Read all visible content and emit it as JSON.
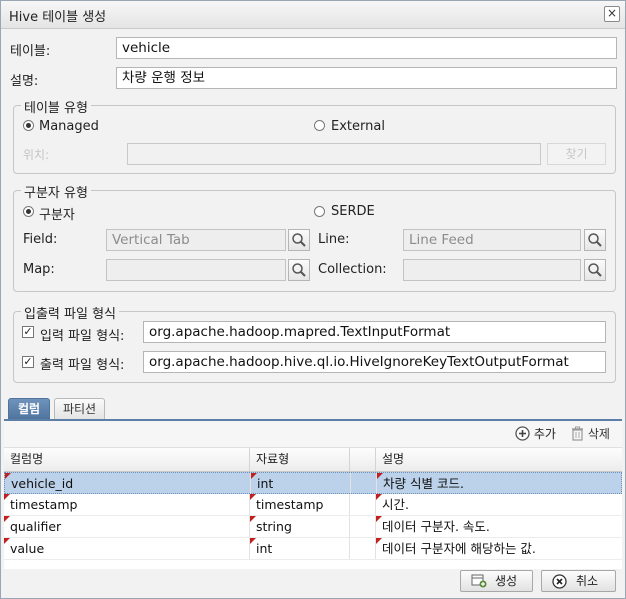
{
  "dialog": {
    "title": "Hive 테이블 생성",
    "close": "×"
  },
  "form": {
    "table_label": "테이블:",
    "table_value": "vehicle",
    "desc_label": "설명:",
    "desc_value": "차량 운행 정보"
  },
  "table_type": {
    "legend": "테이블 유형",
    "managed": "Managed",
    "external": "External",
    "location_label": "위치:",
    "location_value": "",
    "find_button": "찾기"
  },
  "delimiter": {
    "legend": "구분자 유형",
    "delimiter_option": "구분자",
    "serde_option": "SERDE",
    "field_label": "Field:",
    "field_value": "Vertical Tab",
    "line_label": "Line:",
    "line_value": "Line Feed",
    "map_label": "Map:",
    "map_value": "",
    "collection_label": "Collection:",
    "collection_value": ""
  },
  "io_format": {
    "legend": "입출력 파일 형식",
    "input_label": "입력 파일 형식:",
    "input_value": "org.apache.hadoop.mapred.TextInputFormat",
    "output_label": "출력 파일 형식:",
    "output_value": "org.apache.hadoop.hive.ql.io.HiveIgnoreKeyTextOutputFormat"
  },
  "tabs": [
    {
      "label": "컬럼"
    },
    {
      "label": "파티션"
    }
  ],
  "toolbar": {
    "add": "추가",
    "delete": "삭제"
  },
  "grid": {
    "headers": [
      "컬럼명",
      "자료형",
      "",
      "설명"
    ],
    "rows": [
      {
        "name": "vehicle_id",
        "type": "int",
        "desc": "차량 식별 코드."
      },
      {
        "name": "timestamp",
        "type": "timestamp",
        "desc": "시간."
      },
      {
        "name": "qualifier",
        "type": "string",
        "desc": "데이터 구분자. 속도."
      },
      {
        "name": "value",
        "type": "int",
        "desc": "데이터 구분자에 해당하는 값."
      }
    ]
  },
  "footer": {
    "create": "생성",
    "cancel": "취소"
  },
  "colors": {
    "accent": "#4e739c",
    "selected_row": "#bcd2ea",
    "dirty_marker": "#c02020"
  }
}
